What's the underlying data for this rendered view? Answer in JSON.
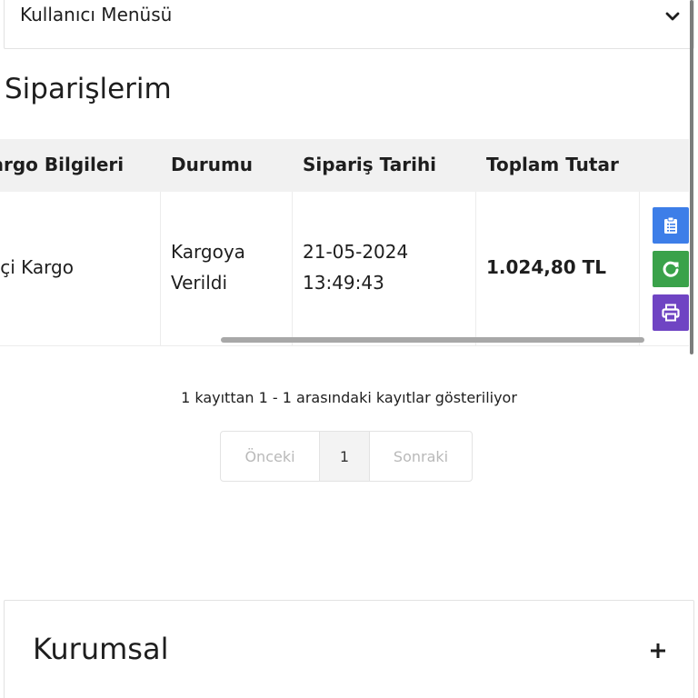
{
  "user_menu": {
    "label": "Kullanıcı Menüsü"
  },
  "page": {
    "title": "Siparişlerim"
  },
  "orders_table": {
    "columns": [
      "Kargo Bilgileri",
      "Durumu",
      "Sipariş Tarihi",
      "Toplam Tutar"
    ],
    "rows": [
      {
        "cargo": "Yurtiçi Kargo",
        "status_line1": "Kargoya",
        "status_line2": "Verildi",
        "date": "21-05-2024",
        "time": "13:49:43",
        "total": "1.024,80 TL"
      }
    ]
  },
  "actions": {
    "colors": {
      "detail": "#3d7ee8",
      "reorder": "#3aa24a",
      "print": "#6f44c3"
    },
    "icons": [
      "clipboard-icon",
      "refresh-icon",
      "printer-icon"
    ]
  },
  "table_info": "1 kayıttan 1 - 1 arasındaki kayıtlar gösteriliyor",
  "pagination": {
    "prev": "Önceki",
    "current": "1",
    "next": "Sonraki"
  },
  "accordion": {
    "title": "Kurumsal",
    "toggle": "+"
  }
}
